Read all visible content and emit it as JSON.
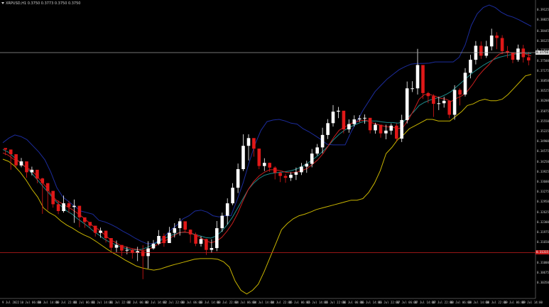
{
  "symbol_bar": {
    "text": "XRPUSD,H1 0.3750 0.3773 0.3750 0.3750"
  },
  "chart_data": {
    "type": "candlestick",
    "title": "",
    "xlabel": "",
    "ylabel": "",
    "ylim": [
      0.3002,
      0.3926
    ],
    "grid": false,
    "x_tick_labels": [
      "9 Jul 2022",
      "10 Jul 06:00",
      "10 Jul 14:00",
      "10 Jul 22:00",
      "11 Jul 06:00",
      "11 Jul 14:00",
      "11 Jul 22:00",
      "12 Jul 06:00",
      "12 Jul 14:00",
      "12 Jul 22:00",
      "13 Jul 06:00",
      "13 Jul 14:00",
      "13 Jul 22:00",
      "14 Jul 06:00",
      "14 Jul 14:00",
      "14 Jul 22:00",
      "15 Jul 06:00",
      "15 Jul 14:00",
      "15 Jul 22:00",
      "16 Jul 06:00",
      "16 Jul 14:00",
      "16 Jul 22:00",
      "17 Jul 06:00",
      "17 Jul 14:00",
      "17 Jul 22:00",
      "18 Jul 06:00",
      "18 Jul 14:00",
      "18 Jul 22:00",
      "19 Jul 06:00",
      "19 Jul 14:00"
    ],
    "y_tick_labels": [
      "0.39125",
      "0.38825",
      "0.38445",
      "0.38125",
      "0.37825",
      "0.37500",
      "0.37175",
      "0.36850",
      "0.36525",
      "0.36200",
      "0.35875",
      "0.35550",
      "0.35225",
      "0.34900",
      "0.34575",
      "0.34250",
      "0.33925",
      "0.33600",
      "0.33275",
      "0.32950",
      "0.32625",
      "0.32300",
      "0.31975",
      "0.31650",
      "0.31325",
      "0.31000",
      "0.30675",
      "0.30350"
    ],
    "current_price": "0.37750",
    "red_line_price": "0.31315",
    "overlays": [
      {
        "kind": "bollinger_upper",
        "color": "#1c2c9c"
      },
      {
        "kind": "bollinger_middle",
        "color": "#1e8a8a"
      },
      {
        "kind": "bollinger_lower",
        "color": "#c8b400"
      },
      {
        "kind": "moving_average",
        "color": "#c81e1e"
      }
    ],
    "series": [
      {
        "kind": "close",
        "values": [
          0.3463,
          0.3448,
          0.3412,
          0.3425,
          0.339,
          0.3398,
          0.337,
          0.3355,
          0.333,
          0.3287,
          0.3265,
          0.329,
          0.3278,
          0.3282,
          0.3245,
          0.323,
          0.3218,
          0.3195,
          0.3202,
          0.3178,
          0.3147,
          0.3156,
          0.3138,
          0.314,
          0.313,
          0.3136,
          0.312,
          0.3145,
          0.316,
          0.3185,
          0.3162,
          0.3195,
          0.321,
          0.3232,
          0.3205,
          0.319,
          0.316,
          0.3175,
          0.314,
          0.3146,
          0.321,
          0.325,
          0.329,
          0.334,
          0.34,
          0.3475,
          0.35,
          0.3466,
          0.341,
          0.342,
          0.3405,
          0.3388,
          0.3378,
          0.3372,
          0.3382,
          0.339,
          0.3408,
          0.3417,
          0.345,
          0.347,
          0.351,
          0.3548,
          0.3585,
          0.3588,
          0.3528,
          0.3545,
          0.356,
          0.3563,
          0.3565,
          0.3525,
          0.3543,
          0.3515,
          0.3524,
          0.354,
          0.3498,
          0.3558,
          0.366,
          0.366,
          0.3735,
          0.3645,
          0.3635,
          0.361,
          0.3612,
          0.362,
          0.3575,
          0.3655,
          0.364,
          0.371,
          0.3752,
          0.3797,
          0.3765,
          0.3795,
          0.383,
          0.3822,
          0.378,
          0.3775,
          0.3752,
          0.3788,
          0.376,
          0.375
        ]
      },
      {
        "kind": "high",
        "values": [
          0.3468,
          0.3458,
          0.343,
          0.3436,
          0.34,
          0.3408,
          0.3382,
          0.3372,
          0.3338,
          0.331,
          0.3299,
          0.3315,
          0.3298,
          0.3302,
          0.3267,
          0.3241,
          0.3227,
          0.3214,
          0.3212,
          0.3185,
          0.317,
          0.317,
          0.3156,
          0.315,
          0.3144,
          0.315,
          0.3155,
          0.3168,
          0.3172,
          0.3204,
          0.3193,
          0.3214,
          0.3226,
          0.3242,
          0.3226,
          0.3206,
          0.3196,
          0.3184,
          0.3176,
          0.3174,
          0.3233,
          0.326,
          0.3306,
          0.3355,
          0.3418,
          0.3512,
          0.3512,
          0.3482,
          0.3454,
          0.3435,
          0.3421,
          0.3409,
          0.3392,
          0.3385,
          0.339,
          0.3405,
          0.342,
          0.3427,
          0.3465,
          0.3481,
          0.3533,
          0.3561,
          0.3606,
          0.36,
          0.3579,
          0.356,
          0.3573,
          0.3574,
          0.3576,
          0.3564,
          0.3549,
          0.3534,
          0.3543,
          0.3547,
          0.3547,
          0.3575,
          0.3682,
          0.3683,
          0.3787,
          0.3723,
          0.3649,
          0.3641,
          0.3633,
          0.3633,
          0.362,
          0.367,
          0.366,
          0.3725,
          0.3768,
          0.3812,
          0.3811,
          0.3813,
          0.3852,
          0.3841,
          0.3831,
          0.3796,
          0.3775,
          0.3801,
          0.38,
          0.3777
        ]
      },
      {
        "kind": "low",
        "values": [
          0.3445,
          0.3398,
          0.3405,
          0.3406,
          0.3372,
          0.338,
          0.3355,
          0.3256,
          0.3268,
          0.3276,
          0.3255,
          0.326,
          0.3259,
          0.3227,
          0.3213,
          0.3211,
          0.321,
          0.3183,
          0.3179,
          0.3164,
          0.3137,
          0.3133,
          0.312,
          0.3126,
          0.3112,
          0.3104,
          0.3046,
          0.308,
          0.3141,
          0.3155,
          0.315,
          0.3163,
          0.318,
          0.3186,
          0.3195,
          0.3163,
          0.3152,
          0.3151,
          0.3124,
          0.313,
          0.3136,
          0.3198,
          0.3222,
          0.3284,
          0.3323,
          0.3394,
          0.3428,
          0.344,
          0.34,
          0.3394,
          0.3391,
          0.3367,
          0.3358,
          0.3356,
          0.3362,
          0.3365,
          0.3381,
          0.3388,
          0.3406,
          0.3444,
          0.3451,
          0.3497,
          0.3537,
          0.3564,
          0.3515,
          0.3517,
          0.3537,
          0.3552,
          0.3546,
          0.3515,
          0.3514,
          0.3501,
          0.3496,
          0.3511,
          0.349,
          0.3487,
          0.3547,
          0.3648,
          0.364,
          0.3626,
          0.3612,
          0.3568,
          0.359,
          0.3598,
          0.3564,
          0.3559,
          0.3605,
          0.3634,
          0.3692,
          0.3737,
          0.3755,
          0.3758,
          0.3782,
          0.3786,
          0.377,
          0.3758,
          0.3741,
          0.3746,
          0.3743,
          0.3734
        ]
      },
      {
        "kind": "bollinger_upper",
        "values": [
          0.3485,
          0.35,
          0.351,
          0.3505,
          0.3495,
          0.3475,
          0.3455,
          0.343,
          0.339,
          0.334,
          0.331,
          0.3295,
          0.328,
          0.3265,
          0.326,
          0.3255,
          0.3235,
          0.323,
          0.3222,
          0.3212,
          0.32,
          0.319,
          0.3178,
          0.3168,
          0.316,
          0.316,
          0.317,
          0.3185,
          0.3205,
          0.322,
          0.324,
          0.325,
          0.3265,
          0.3268,
          0.3262,
          0.325,
          0.3246,
          0.325,
          0.325,
          0.33,
          0.3355,
          0.342,
          0.348,
          0.3525,
          0.3553,
          0.3558,
          0.356,
          0.3555,
          0.3548,
          0.3545,
          0.353,
          0.352,
          0.3508,
          0.3495,
          0.348,
          0.3478,
          0.3478,
          0.3478,
          0.352,
          0.3555,
          0.359,
          0.362,
          0.365,
          0.367,
          0.369,
          0.3705,
          0.372,
          0.373,
          0.3738,
          0.374,
          0.374,
          0.3741,
          0.3745,
          0.3745,
          0.3745,
          0.3745,
          0.376,
          0.38,
          0.3862,
          0.39,
          0.392,
          0.3928,
          0.392,
          0.3905,
          0.3895,
          0.3889,
          0.388,
          0.387,
          0.386
        ]
      },
      {
        "kind": "bollinger_middle",
        "values": [
          0.3463,
          0.3455,
          0.344,
          0.3425,
          0.341,
          0.3395,
          0.3375,
          0.3355,
          0.3335,
          0.3315,
          0.3295,
          0.328,
          0.3265,
          0.3255,
          0.324,
          0.3228,
          0.3215,
          0.32,
          0.3188,
          0.3175,
          0.3165,
          0.3158,
          0.315,
          0.3145,
          0.314,
          0.314,
          0.3142,
          0.3148,
          0.3155,
          0.3165,
          0.3175,
          0.3183,
          0.319,
          0.3195,
          0.3197,
          0.3195,
          0.319,
          0.3185,
          0.318,
          0.3178,
          0.3185,
          0.32,
          0.322,
          0.3245,
          0.3275,
          0.3305,
          0.3335,
          0.3355,
          0.337,
          0.338,
          0.3385,
          0.3388,
          0.339,
          0.3392,
          0.3395,
          0.34,
          0.3408,
          0.3418,
          0.343,
          0.3443,
          0.3458,
          0.3475,
          0.3495,
          0.3512,
          0.3525,
          0.3535,
          0.3543,
          0.355,
          0.3555,
          0.3555,
          0.3555,
          0.3552,
          0.355,
          0.355,
          0.3548,
          0.3552,
          0.3568,
          0.3585,
          0.3605,
          0.3615,
          0.3622,
          0.3627,
          0.3632,
          0.364,
          0.365,
          0.3665,
          0.368,
          0.3695,
          0.371,
          0.3722,
          0.3734,
          0.3744,
          0.3753,
          0.376,
          0.3764,
          0.3768,
          0.377,
          0.3772,
          0.3772,
          0.3772
        ]
      },
      {
        "kind": "bollinger_lower",
        "values": [
          0.3432,
          0.3425,
          0.341,
          0.339,
          0.3365,
          0.3335,
          0.331,
          0.3275,
          0.326,
          0.325,
          0.3233,
          0.322,
          0.321,
          0.3198,
          0.3188,
          0.318,
          0.3168,
          0.3155,
          0.3142,
          0.313,
          0.312,
          0.3108,
          0.3098,
          0.3088,
          0.3082,
          0.3078,
          0.3075,
          0.3078,
          0.3084,
          0.309,
          0.3095,
          0.31,
          0.3105,
          0.311,
          0.3112,
          0.3112,
          0.3112,
          0.311,
          0.3102,
          0.3085,
          0.304,
          0.301,
          0.2998,
          0.301,
          0.303,
          0.307,
          0.3115,
          0.316,
          0.3205,
          0.3225,
          0.324,
          0.325,
          0.3255,
          0.3262,
          0.327,
          0.3275,
          0.328,
          0.3285,
          0.329,
          0.3295,
          0.33,
          0.33,
          0.3305,
          0.3325,
          0.3355,
          0.3395,
          0.345,
          0.347,
          0.3495,
          0.351,
          0.353,
          0.354,
          0.355,
          0.356,
          0.356,
          0.3555,
          0.3555,
          0.3555,
          0.357,
          0.3585,
          0.3605,
          0.361,
          0.362,
          0.3625,
          0.362,
          0.362,
          0.3625,
          0.364,
          0.366,
          0.368,
          0.37,
          0.3705
        ]
      },
      {
        "kind": "moving_average",
        "values": [
          0.3452,
          0.3445,
          0.3432,
          0.3425,
          0.341,
          0.34,
          0.3385,
          0.3365,
          0.3345,
          0.332,
          0.33,
          0.329,
          0.328,
          0.327,
          0.3258,
          0.3245,
          0.323,
          0.3215,
          0.3205,
          0.319,
          0.3175,
          0.3165,
          0.3155,
          0.315,
          0.3145,
          0.3142,
          0.3138,
          0.314,
          0.3147,
          0.3158,
          0.3165,
          0.3175,
          0.3185,
          0.3195,
          0.3198,
          0.3195,
          0.3188,
          0.318,
          0.317,
          0.3163,
          0.3168,
          0.318,
          0.32,
          0.3225,
          0.3258,
          0.3298,
          0.3335,
          0.336,
          0.3378,
          0.339,
          0.3398,
          0.3398,
          0.3395,
          0.339,
          0.3388,
          0.339,
          0.3395,
          0.3402,
          0.3415,
          0.343,
          0.345,
          0.3475,
          0.3502,
          0.3525,
          0.3535,
          0.3545,
          0.3552,
          0.3556,
          0.3558,
          0.355,
          0.3545,
          0.354,
          0.3536,
          0.3535,
          0.353,
          0.3535,
          0.356,
          0.359,
          0.3625,
          0.364,
          0.364,
          0.3635,
          0.3628,
          0.3625,
          0.3618,
          0.3628,
          0.3636,
          0.365,
          0.3672,
          0.3698,
          0.3718,
          0.3735,
          0.3755,
          0.377,
          0.3775,
          0.3775,
          0.3772,
          0.3775,
          0.377,
          0.3764
        ]
      }
    ]
  }
}
